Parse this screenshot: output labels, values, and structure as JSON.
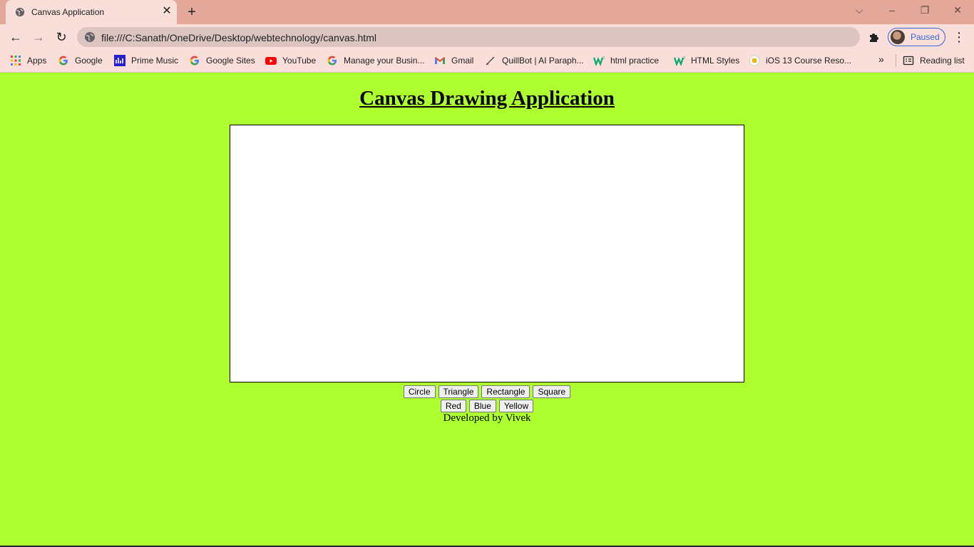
{
  "browser": {
    "tab": {
      "title": "Canvas Application"
    },
    "address": {
      "url": "file:///C:Sanath/OneDrive/Desktop/webtechnology/canvas.html"
    },
    "profile": {
      "label": "Paused"
    },
    "bookmarks": [
      {
        "label": "Apps",
        "icon": "apps-grid-icon"
      },
      {
        "label": "Google",
        "icon": "google-icon"
      },
      {
        "label": "Prime Music",
        "icon": "prime-music-icon"
      },
      {
        "label": "Google Sites",
        "icon": "google-icon"
      },
      {
        "label": "YouTube",
        "icon": "youtube-icon"
      },
      {
        "label": "Manage your Busin...",
        "icon": "google-icon"
      },
      {
        "label": "Gmail",
        "icon": "gmail-icon"
      },
      {
        "label": "QuillBot | AI Paraph...",
        "icon": "quillbot-icon"
      },
      {
        "label": "html practice",
        "icon": "w3schools-icon"
      },
      {
        "label": "HTML Styles",
        "icon": "w3schools-icon"
      },
      {
        "label": "iOS 13 Course Reso...",
        "icon": "course-icon"
      }
    ],
    "reading_list": {
      "label": "Reading list"
    }
  },
  "page": {
    "heading": "Canvas Drawing Application",
    "shape_buttons": [
      "Circle",
      "Triangle",
      "Rectangle",
      "Square"
    ],
    "color_buttons": [
      "Red",
      "Blue",
      "Yellow"
    ],
    "credit": "Developed by Vivek"
  },
  "colors": {
    "page_background": "#adff2f",
    "tabstrip": "#e3a89a",
    "toolbar": "#f9ded9",
    "canvas": "#ffffff"
  }
}
